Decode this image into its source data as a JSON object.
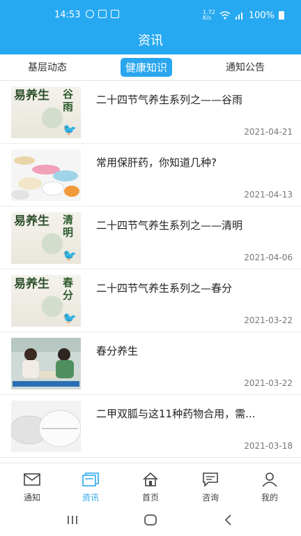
{
  "status": {
    "time": "14:53",
    "speed_top": "1.72",
    "speed_bottom": "K/s",
    "battery": "100%"
  },
  "header": {
    "title": "资讯"
  },
  "tabs": [
    {
      "label": "基层动态"
    },
    {
      "label": "健康知识",
      "active": true
    },
    {
      "label": "通知公告"
    }
  ],
  "news": [
    {
      "title": "二十四节气养生系列之——谷雨",
      "date": "2021-04-21",
      "thumb": "season-guyu"
    },
    {
      "title": "常用保肝药，你知道几种?",
      "date": "2021-04-13",
      "thumb": "pills"
    },
    {
      "title": "二十四节气养生系列之——清明",
      "date": "2021-04-06",
      "thumb": "season-qingming"
    },
    {
      "title": "二十四节气养生系列之—春分",
      "date": "2021-03-22",
      "thumb": "season-chunfen"
    },
    {
      "title": "春分养生",
      "date": "2021-03-22",
      "thumb": "video-still"
    },
    {
      "title": "二甲双胍与这11种药物合用，需...",
      "date": "2021-03-18",
      "thumb": "tablets"
    }
  ],
  "thumb_text": {
    "big": "易养生",
    "guyu": "谷雨",
    "qingming": "清明",
    "chunfen": "春分",
    "bird": "🐦"
  },
  "bottom_nav": [
    {
      "label": "通知",
      "icon": "mail-icon"
    },
    {
      "label": "资讯",
      "icon": "news-icon",
      "active": true
    },
    {
      "label": "首页",
      "icon": "home-icon"
    },
    {
      "label": "咨询",
      "icon": "chat-icon"
    },
    {
      "label": "我的",
      "icon": "person-icon"
    }
  ],
  "colors": {
    "primary": "#27a9f2",
    "active_tab": "#29a6ee",
    "text": "#222222",
    "muted": "#777777"
  }
}
